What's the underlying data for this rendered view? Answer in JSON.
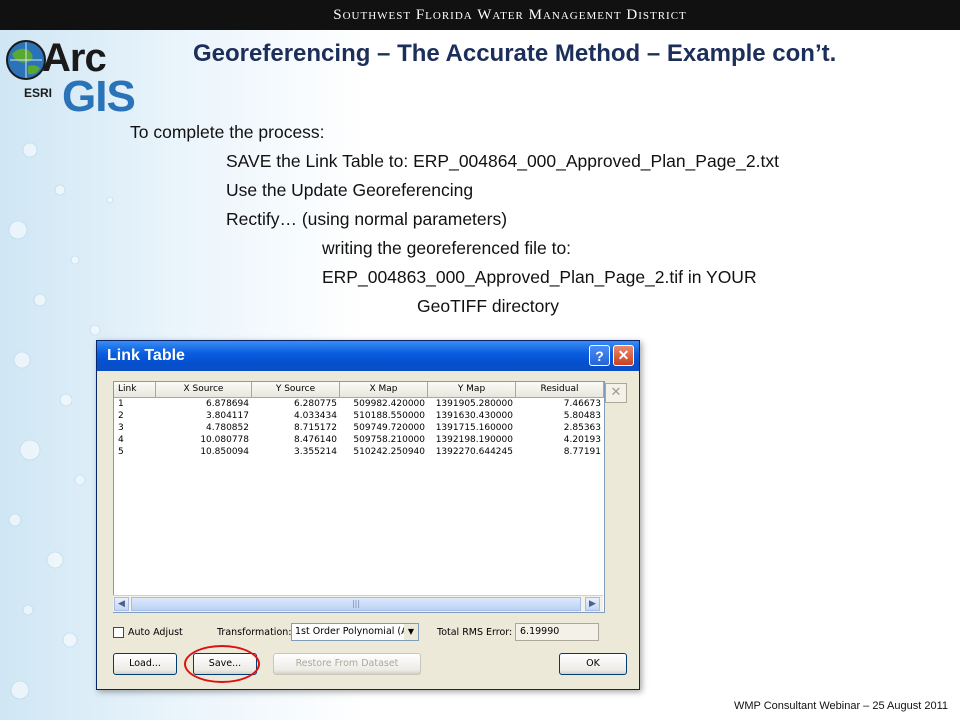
{
  "header": {
    "org": "Southwest Florida Water Management District"
  },
  "logo": {
    "arc": "Arc",
    "gis": "GIS",
    "esri": "ESRI"
  },
  "slide": {
    "title": "Georeferencing – The Accurate Method – Example con’t.",
    "lines": [
      "To complete the process:",
      "SAVE the Link Table to:  ERP_004864_000_Approved_Plan_Page_2.txt",
      "Use the Update Georeferencing",
      "Rectify… (using normal parameters)",
      "writing the georeferenced file to:",
      "ERP_004863_000_Approved_Plan_Page_2.tif in YOUR",
      "GeoTIFF directory"
    ]
  },
  "dialog": {
    "title": "Link Table",
    "help_glyph": "?",
    "close_glyph": "✕",
    "columns": [
      "Link",
      "X Source",
      "Y Source",
      "X Map",
      "Y Map",
      "Residual"
    ],
    "rows": [
      [
        "1",
        "6.878694",
        "6.280775",
        "509982.420000",
        "1391905.280000",
        "7.46673"
      ],
      [
        "2",
        "3.804117",
        "4.033434",
        "510188.550000",
        "1391630.430000",
        "5.80483"
      ],
      [
        "3",
        "4.780852",
        "8.715172",
        "509749.720000",
        "1391715.160000",
        "2.85363"
      ],
      [
        "4",
        "10.080778",
        "8.476140",
        "509758.210000",
        "1392198.190000",
        "4.20193"
      ],
      [
        "5",
        "10.850094",
        "3.355214",
        "510242.250940",
        "1392270.644245",
        "8.77191"
      ]
    ],
    "delete_glyph": "✕",
    "auto_adjust_label": "Auto Adjust",
    "transformation_label": "Transformation:",
    "transformation_value": "1st Order Polynomial (A",
    "rms_label": "Total RMS Error:",
    "rms_value": "6.19990",
    "buttons": {
      "load": "Load...",
      "save": "Save...",
      "restore": "Restore From Dataset",
      "ok": "OK"
    }
  },
  "footer": "WMP Consultant Webinar – 25 August 2011"
}
